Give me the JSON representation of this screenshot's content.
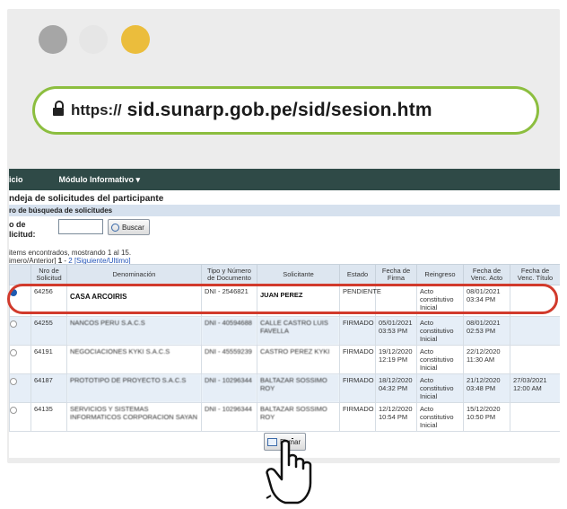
{
  "browser": {
    "window_dots": [
      {
        "name": "dot-gray",
        "color": "#a6a6a6"
      },
      {
        "name": "dot-light",
        "color": "#e6e6e6"
      },
      {
        "name": "dot-yellow",
        "color": "#ebbd3c"
      }
    ],
    "url_protocol": "https://",
    "url_host": "sid.sunarp.gob.pe/sid/sesion.htm"
  },
  "menu": {
    "item1": "icio",
    "item2": "Módulo Informativo ▾"
  },
  "panel": {
    "title": "ndeja de solicitudes del participante",
    "filter_title": "ro de búsqueda de solicitudes",
    "request_label_1": "o de",
    "request_label_2": "licitud:",
    "request_input_value": "",
    "search_button": "Buscar",
    "found_text": " items encontrados, mostrando 1 al 15.",
    "pager_prefix": "imero/Anterior] ",
    "pager_current": "1",
    "pager_sep": "- ",
    "pager_page2": "2",
    "pager_next": "[Siguiente/Ultimo]"
  },
  "table": {
    "columns": [
      "",
      "Nro de Solicitud",
      "Denominación",
      "Tipo y Número de Documento",
      "Solicitante",
      "Estado",
      "Fecha de Firma",
      "Reingreso",
      "Fecha de Venc. Acto",
      "Fecha de Venc. Título"
    ],
    "rows": [
      {
        "nro": "64256",
        "denominacion": "CASA ARCOIRIS",
        "documento": "DNI - 2546821",
        "solicitante": "JUAN PEREZ",
        "estado": "PENDIENTE",
        "firma": "",
        "reingreso": "Acto constitutivo Inicial",
        "venc_acto": "08/01/2021 03:34 PM",
        "venc_titulo": ""
      },
      {
        "nro": "64255",
        "denominacion": "NANCOS PERU S.A.C.S",
        "documento": "DNI - 40594688",
        "solicitante": "CALLE CASTRO LUIS FAVELLA",
        "estado": "FIRMADO",
        "firma": "05/01/2021 03:53 PM",
        "reingreso": "Acto constitutivo Inicial",
        "venc_acto": "08/01/2021 02:53 PM",
        "venc_titulo": ""
      },
      {
        "nro": "64191",
        "denominacion": "NEGOCIACIONES KYKI S.A.C.S",
        "documento": "DNI - 45559239",
        "solicitante": "CASTRO PEREZ KYKI",
        "estado": "FIRMADO",
        "firma": "19/12/2020 12:19 PM",
        "reingreso": "Acto constitutivo Inicial",
        "venc_acto": "22/12/2020 11:30 AM",
        "venc_titulo": ""
      },
      {
        "nro": "64187",
        "denominacion": "PROTOTIPO DE PROYECTO S.A.C.S",
        "documento": "DNI - 10296344",
        "solicitante": "BALTAZAR SOSSIMO ROY",
        "estado": "FIRMADO",
        "firma": "18/12/2020 04:32 PM",
        "reingreso": "Acto constitutivo Inicial",
        "venc_acto": "21/12/2020 03:48 PM",
        "venc_titulo": "27/03/2021 12:00 AM"
      },
      {
        "nro": "64135",
        "denominacion": "SERVICIOS Y SISTEMAS INFORMATICOS CORPORACION SAYAN",
        "documento": "DNI - 10296344",
        "solicitante": "BALTAZAR SOSSIMO ROY",
        "estado": "FIRMADO",
        "firma": "12/12/2020 10:54 PM",
        "reingreso": "Acto constitutivo Inicial",
        "venc_acto": "15/12/2020 10:50 PM",
        "venc_titulo": ""
      }
    ]
  },
  "actions": {
    "sign_button": "Firmar"
  },
  "overlay": {
    "highlight_color": "#d13a2c",
    "urlbar_border_color": "#8cbe3f",
    "cursor": "pointing-hand-cursor-icon"
  }
}
